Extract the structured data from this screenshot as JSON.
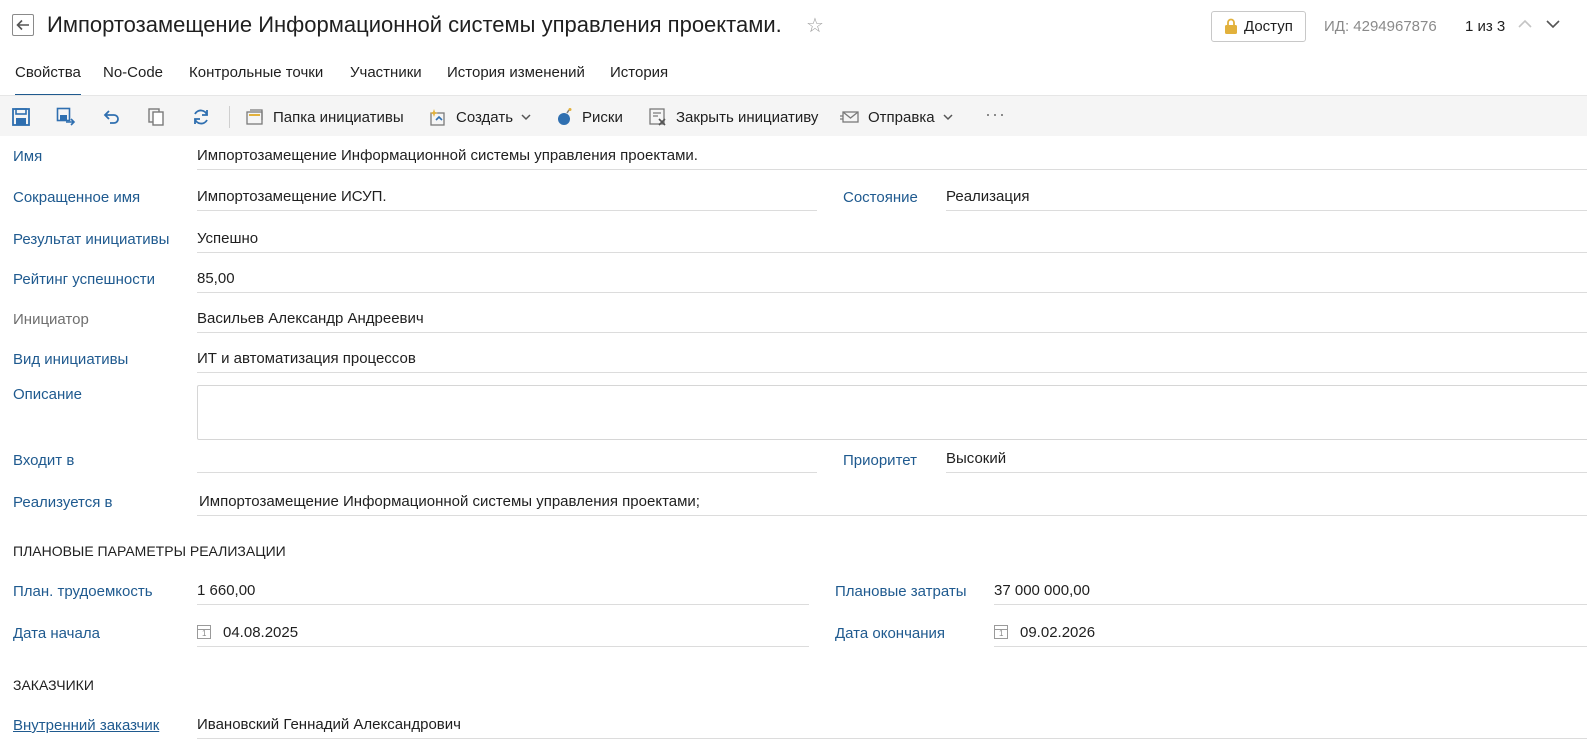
{
  "header": {
    "title": "Импортозамещение Информационной системы управления проектами.",
    "access_label": "Доступ",
    "id_text": "ИД: 4294967876",
    "pager": "1 из 3"
  },
  "tabs": [
    {
      "label": "Свойства"
    },
    {
      "label": "No-Code"
    },
    {
      "label": "Контрольные точки"
    },
    {
      "label": "Участники"
    },
    {
      "label": "История изменений"
    },
    {
      "label": "История"
    }
  ],
  "toolbar": {
    "folder_label": "Папка инициативы",
    "create_label": "Создать",
    "risks_label": "Риски",
    "close_label": "Закрыть инициативу",
    "send_label": "Отправка",
    "more_label": "···"
  },
  "form": {
    "name": {
      "label": "Имя",
      "value": "Импортозамещение Информационной системы управления проектами."
    },
    "short_name": {
      "label": "Сокращенное имя",
      "value": "Импортозамещение ИСУП."
    },
    "state": {
      "label": "Состояние",
      "value": "Реализация"
    },
    "result": {
      "label": "Результат инициативы",
      "value": "Успешно"
    },
    "rating": {
      "label": "Рейтинг успешности",
      "value": "85,00"
    },
    "initiator": {
      "label": "Инициатор",
      "value": "Васильев Александр Андреевич"
    },
    "kind": {
      "label": "Вид инициативы",
      "value": "ИТ и автоматизация процессов"
    },
    "description": {
      "label": "Описание",
      "value": ""
    },
    "part_of": {
      "label": "Входит в",
      "value": ""
    },
    "priority": {
      "label": "Приоритет",
      "value": "Высокий"
    },
    "realized_in": {
      "label": "Реализуется в",
      "value": "Импортозамещение Информационной системы управления проектами;"
    }
  },
  "plan": {
    "section_title": "ПЛАНОВЫЕ ПАРАМЕТРЫ РЕАЛИЗАЦИИ",
    "labor": {
      "label": "План. трудоемкость",
      "value": "1 660,00"
    },
    "costs": {
      "label": "Плановые затраты",
      "value": "37 000 000,00"
    },
    "start": {
      "label": "Дата начала",
      "value": "04.08.2025"
    },
    "end": {
      "label": "Дата окончания",
      "value": "09.02.2026"
    },
    "cal_day": "1"
  },
  "customers": {
    "section_title": "ЗАКАЗЧИКИ",
    "internal": {
      "label": "Внутренний заказчик",
      "value": "Ивановский Геннадий Александрович"
    }
  },
  "colors": {
    "accent": "#1f5a8f",
    "icon_blue": "#2f6fb0",
    "folder_yellow": "#e2b13c"
  }
}
